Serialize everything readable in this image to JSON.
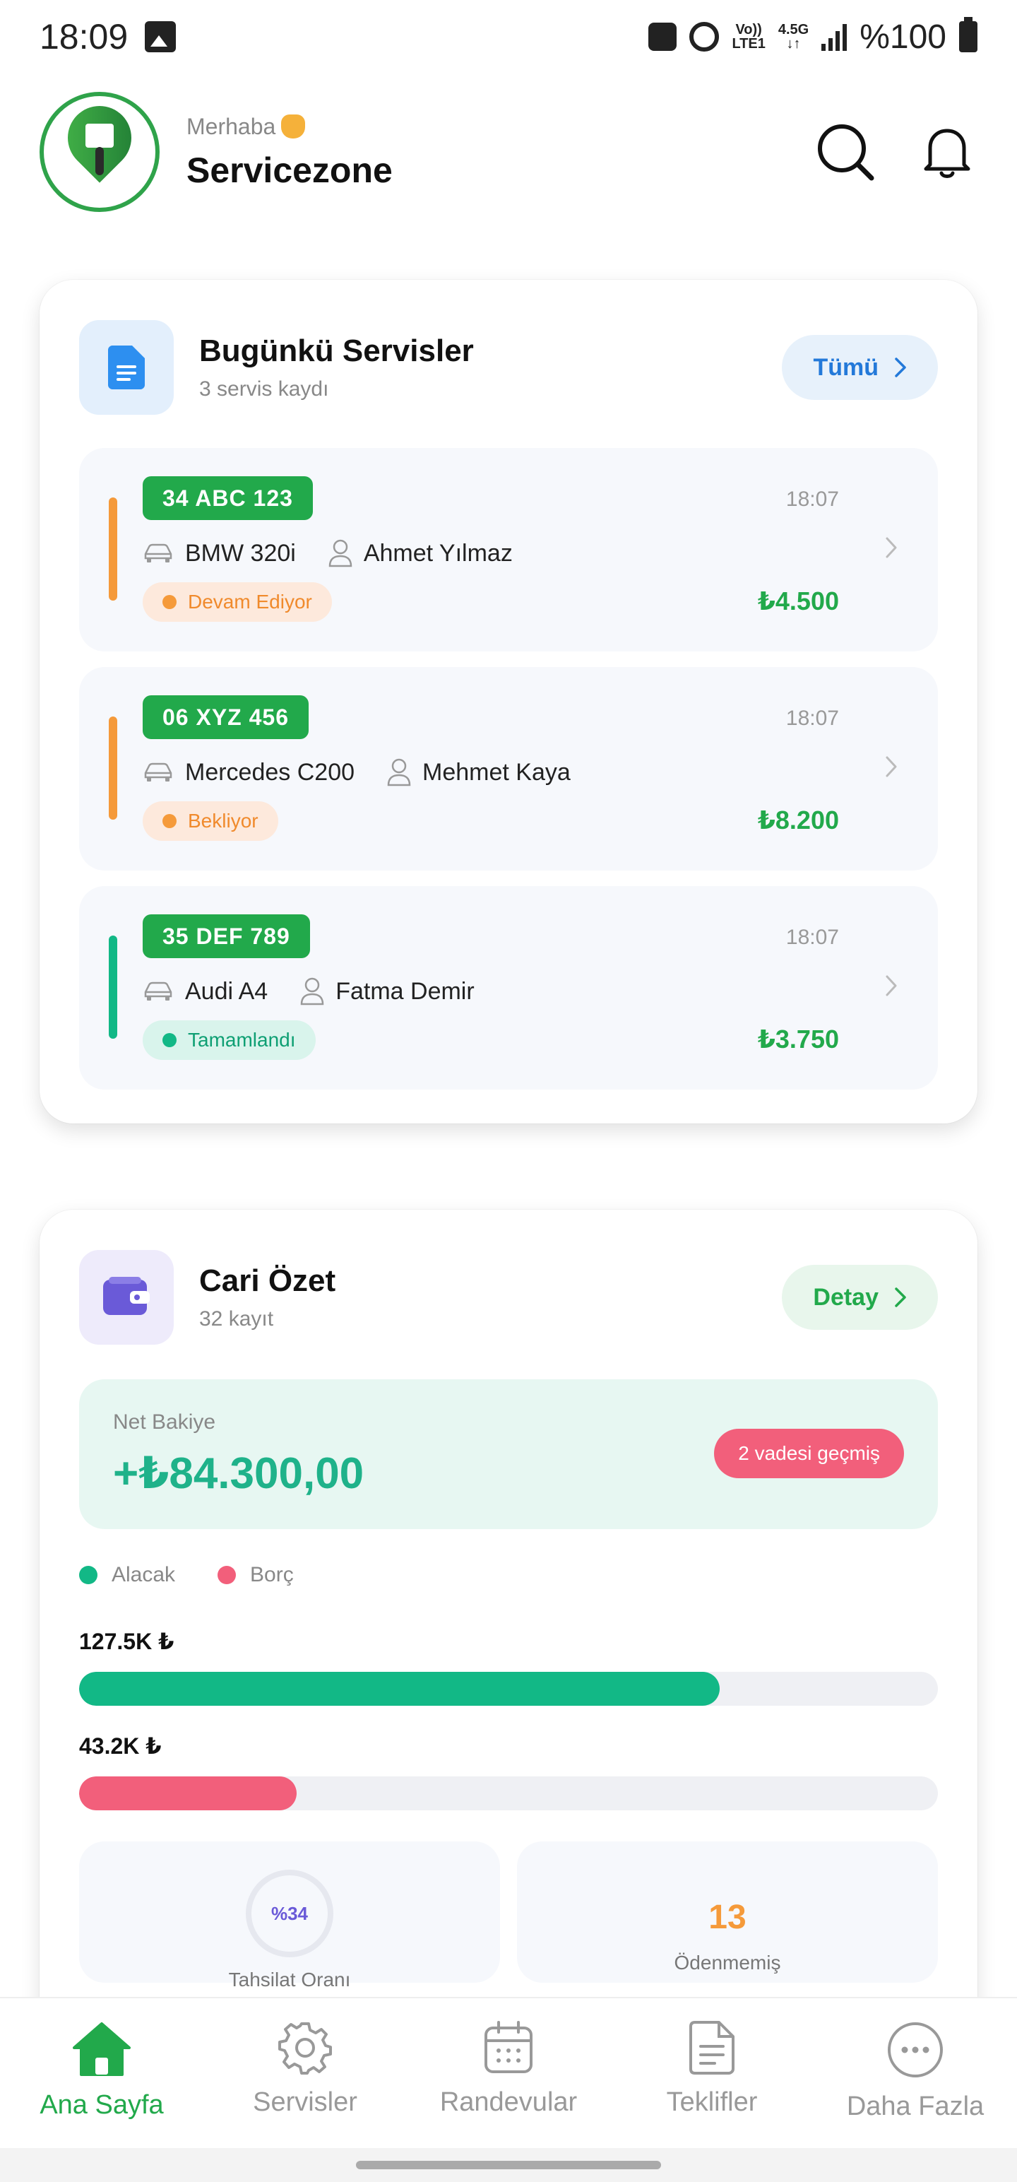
{
  "status_bar": {
    "time": "18:09",
    "network_top": "Vo))",
    "network_bottom": "LTE1",
    "network_gen": "4.5G",
    "battery": "%100"
  },
  "header": {
    "greeting": "Merhaba",
    "brand": "Servicezone"
  },
  "services_card": {
    "title": "Bugünkü Servisler",
    "subtitle": "3 servis kaydı",
    "all_button": "Tümü",
    "items": [
      {
        "plate": "34 ABC 123",
        "time": "18:07",
        "car": "BMW 320i",
        "customer": "Ahmet Yılmaz",
        "status": "Devam Ediyor",
        "status_color": "#f59a3a",
        "amount": "₺4.500"
      },
      {
        "plate": "06 XYZ 456",
        "time": "18:07",
        "car": "Mercedes C200",
        "customer": "Mehmet Kaya",
        "status": "Bekliyor",
        "status_color": "#f59a3a",
        "amount": "₺8.200"
      },
      {
        "plate": "35 DEF 789",
        "time": "18:07",
        "car": "Audi A4",
        "customer": "Fatma Demir",
        "status": "Tamamlandı",
        "status_color": "#12b886",
        "amount": "₺3.750"
      }
    ]
  },
  "cari_card": {
    "title": "Cari Özet",
    "subtitle": "32 kayıt",
    "detail_button": "Detay",
    "net_label": "Net Bakiye",
    "net_value": "+₺84.300,00",
    "overdue": "2 vadesi geçmiş",
    "legend_receivable": "Alacak",
    "legend_debt": "Borç",
    "receivable_amount": "127.5K ₺",
    "receivable_fill": 0.746,
    "debt_amount": "43.2K ₺",
    "debt_fill": 0.253,
    "collection_rate": "%34",
    "collection_label": "Tahsilat Oranı",
    "unpaid_count": "13",
    "unpaid_label": "Ödenmemiş"
  },
  "colors": {
    "brand_green": "#22a94b",
    "receivable": "#12b886",
    "debt": "#f25f7b"
  },
  "bottom_nav": [
    {
      "label": "Ana Sayfa",
      "icon": "home-icon",
      "active": true
    },
    {
      "label": "Servisler",
      "icon": "gear-icon",
      "active": false
    },
    {
      "label": "Randevular",
      "icon": "calendar-icon",
      "active": false
    },
    {
      "label": "Teklifler",
      "icon": "document-icon",
      "active": false
    },
    {
      "label": "Daha Fazla",
      "icon": "more-icon",
      "active": false
    }
  ]
}
